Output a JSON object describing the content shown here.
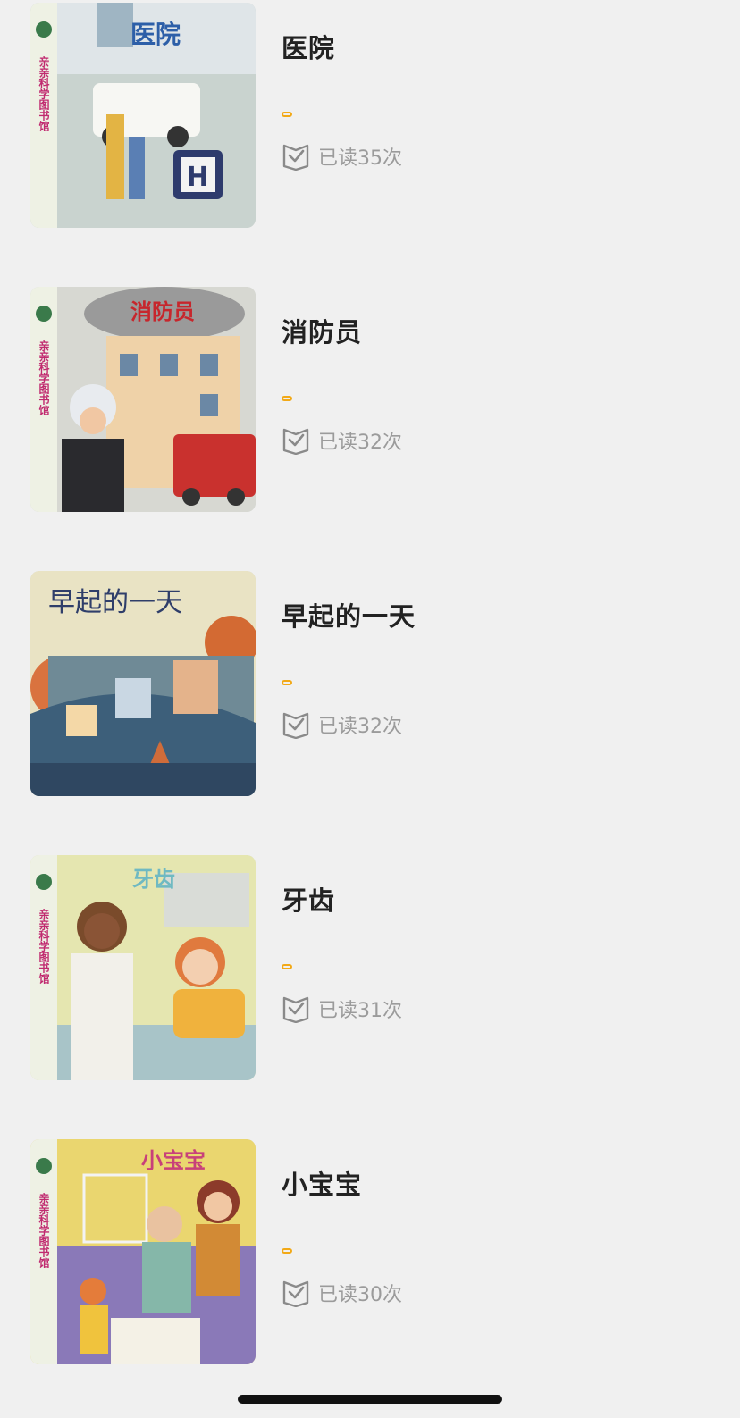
{
  "books": [
    {
      "title": "医院",
      "read_count": "已读35次",
      "cover": {
        "series": "亲亲科学图书馆",
        "title": "医院",
        "title_color": "#2d5fa8",
        "bg": "#c9d3cf",
        "accent": "#3a4b7c"
      }
    },
    {
      "title": "消防员",
      "read_count": "已读32次",
      "cover": {
        "series": "亲亲科学图书馆",
        "title": "消防员",
        "title_color": "#c7262c",
        "bg": "#d7d8d2",
        "accent": "#b5302e"
      }
    },
    {
      "title": "早起的一天",
      "read_count": "已读32次",
      "cover": {
        "series": "",
        "title": "早起的一天",
        "title_color": "#2f3e6a",
        "bg": "#e9e3c4",
        "accent": "#d36a33"
      }
    },
    {
      "title": "牙齿",
      "read_count": "已读31次",
      "cover": {
        "series": "亲亲科学图书馆",
        "title": "牙齿",
        "title_color": "#6fb9c2",
        "bg": "#e5e6b0",
        "accent": "#f0b23d"
      }
    },
    {
      "title": "小宝宝",
      "read_count": "已读30次",
      "cover": {
        "series": "亲亲科学图书馆",
        "title": "小宝宝",
        "title_color": "#c8407a",
        "bg": "#ead66f",
        "accent": "#8a79b8"
      }
    }
  ],
  "colors": {
    "background": "#f0f0f0",
    "title": "#222222",
    "read_text": "#9b9b9b",
    "progress_accent": "#f2a917",
    "home_indicator": "#111111"
  },
  "icons": {
    "read_status": "book-check-icon"
  }
}
